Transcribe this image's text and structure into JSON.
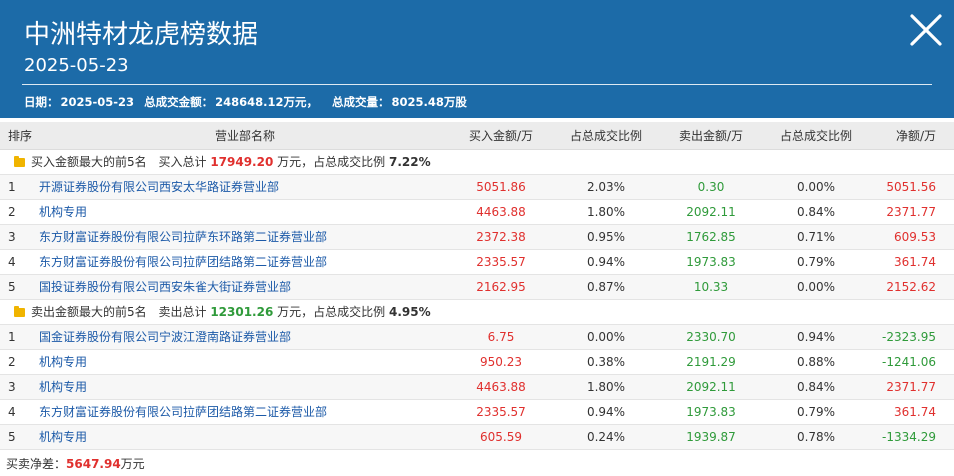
{
  "header": {
    "title": "中洲特材龙虎榜数据",
    "date": "2025-05-23",
    "summary": {
      "date_label": "日期：",
      "date_value": "2025-05-23",
      "turnover_label": "总成交金额：",
      "turnover_value": "248648.12万元，",
      "volume_label": "总成交量：",
      "volume_value": "8025.48万股"
    },
    "close_icon": "close-icon"
  },
  "table": {
    "columns": [
      "排序",
      "营业部名称",
      "买入金额/万",
      "占总成交比例",
      "卖出金额/万",
      "占总成交比例",
      "净额/万"
    ],
    "buy_section": {
      "prefix": "买入金额最大的前5名",
      "total_label": "买入总计",
      "total_value": "17949.20",
      "unit": "万元，占总成交比例",
      "ratio": "7.22%",
      "rows": [
        {
          "rank": "1",
          "name": "开源证券股份有限公司西安太华路证券营业部",
          "buy": "5051.86",
          "buy_pct": "2.03%",
          "sell": "0.30",
          "sell_pct": "0.00%",
          "net": "5051.56",
          "net_color": "red"
        },
        {
          "rank": "2",
          "name": "机构专用",
          "buy": "4463.88",
          "buy_pct": "1.80%",
          "sell": "2092.11",
          "sell_pct": "0.84%",
          "net": "2371.77",
          "net_color": "red"
        },
        {
          "rank": "3",
          "name": "东方财富证券股份有限公司拉萨东环路第二证券营业部",
          "buy": "2372.38",
          "buy_pct": "0.95%",
          "sell": "1762.85",
          "sell_pct": "0.71%",
          "net": "609.53",
          "net_color": "red"
        },
        {
          "rank": "4",
          "name": "东方财富证券股份有限公司拉萨团结路第二证券营业部",
          "buy": "2335.57",
          "buy_pct": "0.94%",
          "sell": "1973.83",
          "sell_pct": "0.79%",
          "net": "361.74",
          "net_color": "red"
        },
        {
          "rank": "5",
          "name": "国投证券股份有限公司西安朱雀大街证券营业部",
          "buy": "2162.95",
          "buy_pct": "0.87%",
          "sell": "10.33",
          "sell_pct": "0.00%",
          "net": "2152.62",
          "net_color": "red"
        }
      ]
    },
    "sell_section": {
      "prefix": "卖出金额最大的前5名",
      "total_label": "卖出总计",
      "total_value": "12301.26",
      "unit": "万元，占总成交比例",
      "ratio": "4.95%",
      "rows": [
        {
          "rank": "1",
          "name": "国金证券股份有限公司宁波江澄南路证券营业部",
          "buy": "6.75",
          "buy_pct": "0.00%",
          "sell": "2330.70",
          "sell_pct": "0.94%",
          "net": "-2323.95",
          "net_color": "green"
        },
        {
          "rank": "2",
          "name": "机构专用",
          "buy": "950.23",
          "buy_pct": "0.38%",
          "sell": "2191.29",
          "sell_pct": "0.88%",
          "net": "-1241.06",
          "net_color": "green"
        },
        {
          "rank": "3",
          "name": "机构专用",
          "buy": "4463.88",
          "buy_pct": "1.80%",
          "sell": "2092.11",
          "sell_pct": "0.84%",
          "net": "2371.77",
          "net_color": "red"
        },
        {
          "rank": "4",
          "name": "东方财富证券股份有限公司拉萨团结路第二证券营业部",
          "buy": "2335.57",
          "buy_pct": "0.94%",
          "sell": "1973.83",
          "sell_pct": "0.79%",
          "net": "361.74",
          "net_color": "red"
        },
        {
          "rank": "5",
          "name": "机构专用",
          "buy": "605.59",
          "buy_pct": "0.24%",
          "sell": "1939.87",
          "sell_pct": "0.78%",
          "net": "-1334.29",
          "net_color": "green"
        }
      ]
    }
  },
  "footer": {
    "label": "买卖净差：",
    "value": "5647.94",
    "unit": "万元"
  },
  "colors": {
    "header_bg": "#1c6ba8",
    "buy_red": "#e0302e",
    "sell_green": "#2f9a3a",
    "link_blue": "#1c5aa8"
  }
}
